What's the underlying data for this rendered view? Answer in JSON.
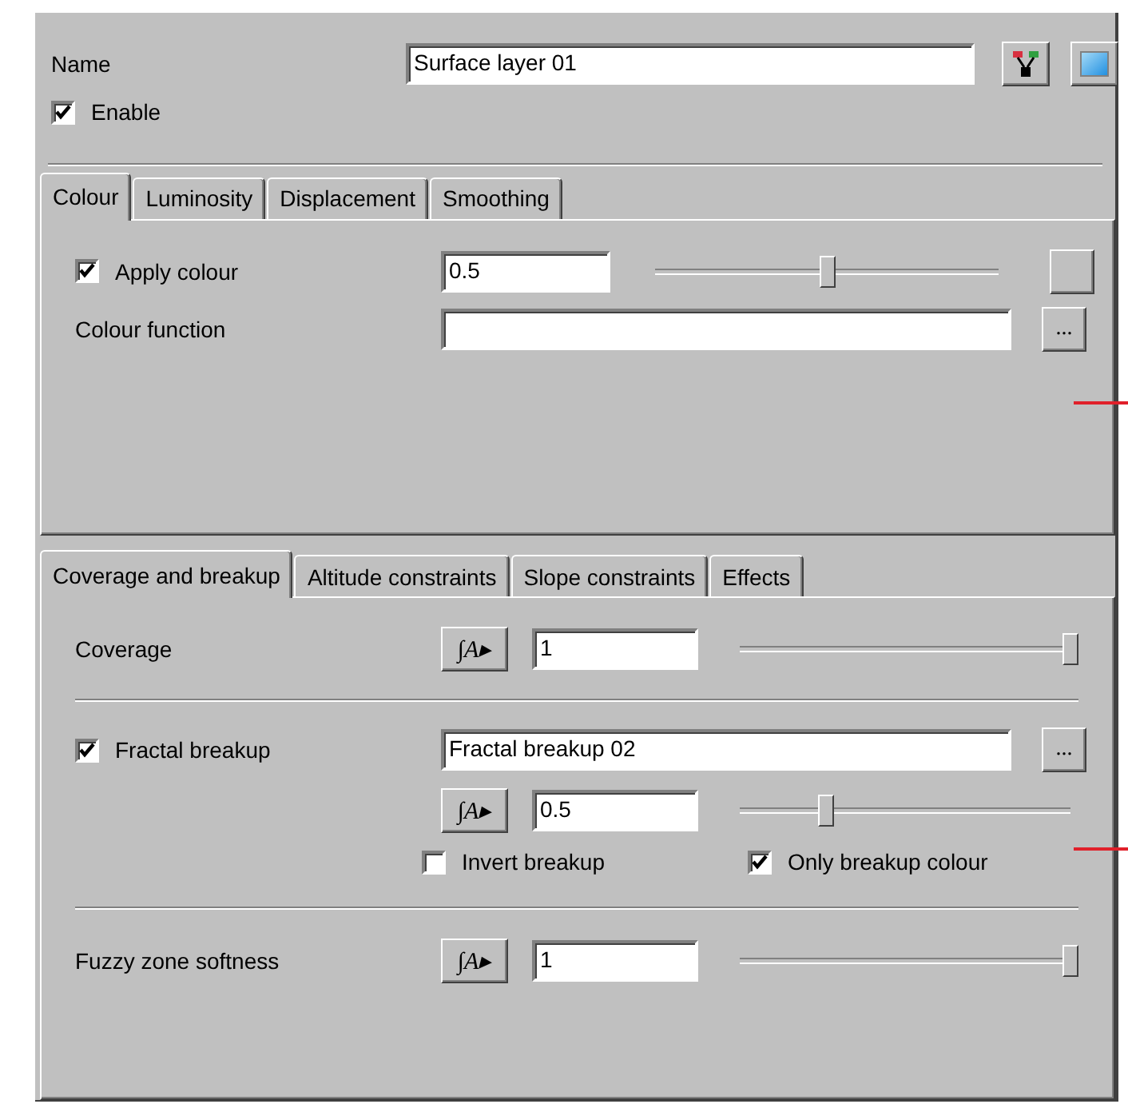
{
  "name_field": {
    "label": "Name",
    "value": "Surface layer 01"
  },
  "enable": {
    "label": "Enable",
    "checked": true
  },
  "material_tabs": [
    {
      "label": "Colour",
      "selected": true
    },
    {
      "label": "Luminosity",
      "selected": false
    },
    {
      "label": "Displacement",
      "selected": false
    },
    {
      "label": "Smoothing",
      "selected": false
    }
  ],
  "apply_colour": {
    "label": "Apply colour",
    "checked": true,
    "value": "0.5",
    "level": 0.5
  },
  "colour_function": {
    "label": "Colour function",
    "browse_label": "..."
  },
  "constraint_tabs": [
    {
      "label": "Coverage and breakup",
      "selected": true
    },
    {
      "label": "Altitude constraints",
      "selected": false
    },
    {
      "label": "Slope constraints",
      "selected": false
    },
    {
      "label": "Effects",
      "selected": false
    }
  ],
  "coverage": {
    "label": "Coverage",
    "fx_label": "∫A▸",
    "value": "1",
    "level": 1
  },
  "fractal_breakup": {
    "label": "Fractal breakup",
    "checked": true,
    "value": "Fractal breakup 02",
    "browse_label": "...",
    "fx_label": "∫A▸",
    "strength": "0.5",
    "level": 0.26,
    "invert": {
      "label": "Invert breakup",
      "checked": false
    },
    "only_colour": {
      "label": "Only breakup colour",
      "checked": true
    }
  },
  "fuzzy_zone_softness": {
    "label": "Fuzzy zone softness",
    "fx_label": "∫A▸",
    "value": "1",
    "level": 1
  }
}
